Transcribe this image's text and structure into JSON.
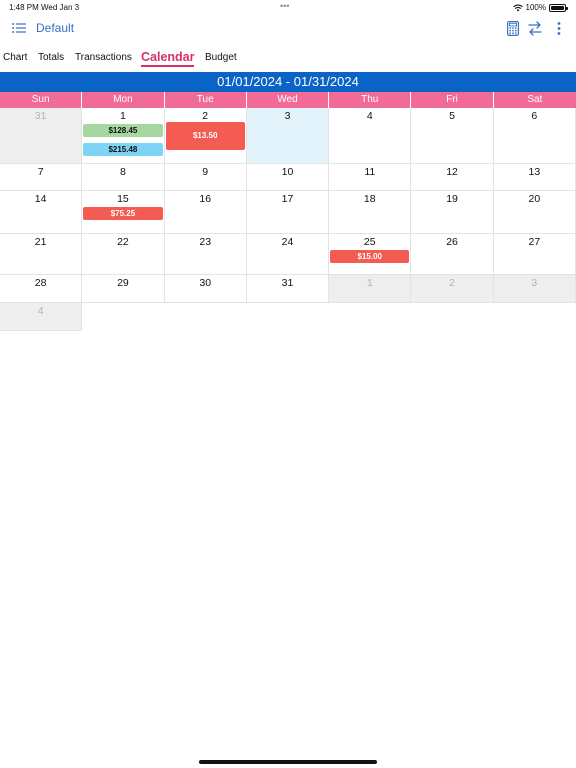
{
  "status_bar": {
    "time": "1:48 PM",
    "date": "Wed Jan 3",
    "battery": "100%",
    "battery_level": 1.0
  },
  "nav": {
    "title": "Default"
  },
  "tabs": [
    {
      "label": "Chart",
      "active": false
    },
    {
      "label": "Totals",
      "active": false
    },
    {
      "label": "Transactions",
      "active": false
    },
    {
      "label": "Calendar",
      "active": true
    },
    {
      "label": "Budget",
      "active": false
    }
  ],
  "calendar": {
    "range": "01/01/2024 - 01/31/2024",
    "weekdays": [
      "Sun",
      "Mon",
      "Tue",
      "Wed",
      "Thu",
      "Fri",
      "Sat"
    ],
    "weeks": [
      [
        {
          "day": "31",
          "other": true
        },
        {
          "day": "1",
          "transactions": [
            {
              "amount": "$128.45",
              "color": "green"
            },
            {
              "amount": "$215.48",
              "color": "blue"
            }
          ]
        },
        {
          "day": "2",
          "transactions": [
            {
              "amount": "$13.50",
              "color": "red",
              "big": true
            }
          ]
        },
        {
          "day": "3",
          "today": true
        },
        {
          "day": "4"
        },
        {
          "day": "5"
        },
        {
          "day": "6"
        }
      ],
      [
        {
          "day": "7"
        },
        {
          "day": "8"
        },
        {
          "day": "9"
        },
        {
          "day": "10"
        },
        {
          "day": "11"
        },
        {
          "day": "12"
        },
        {
          "day": "13"
        }
      ],
      [
        {
          "day": "14"
        },
        {
          "day": "15",
          "transactions": [
            {
              "amount": "$75.25",
              "color": "red"
            }
          ]
        },
        {
          "day": "16"
        },
        {
          "day": "17"
        },
        {
          "day": "18"
        },
        {
          "day": "19"
        },
        {
          "day": "20"
        }
      ],
      [
        {
          "day": "21"
        },
        {
          "day": "22"
        },
        {
          "day": "23"
        },
        {
          "day": "24"
        },
        {
          "day": "25",
          "transactions": [
            {
              "amount": "$15.00",
              "color": "red"
            }
          ]
        },
        {
          "day": "26"
        },
        {
          "day": "27"
        }
      ],
      [
        {
          "day": "28"
        },
        {
          "day": "29"
        },
        {
          "day": "30"
        },
        {
          "day": "31"
        },
        {
          "day": "1",
          "other": true
        },
        {
          "day": "2",
          "other": true
        },
        {
          "day": "3",
          "other": true
        }
      ],
      [
        {
          "day": "4",
          "other": true
        }
      ]
    ]
  },
  "colors": {
    "accent": "#d6306e",
    "header_blue": "#0a63c7",
    "weekday_pink": "#f06b96",
    "nav_blue": "#3a6fc4",
    "tx_green": "#a7d7a0",
    "tx_blue": "#7fd3f5",
    "tx_red": "#f45b52",
    "today_bg": "#e2f3fb"
  },
  "icons": {
    "menu": "list-icon",
    "calculator": "calculator-icon",
    "swap": "swap-arrows-icon",
    "more": "more-vertical-icon",
    "wifi": "wifi-icon",
    "battery": "battery-icon"
  }
}
